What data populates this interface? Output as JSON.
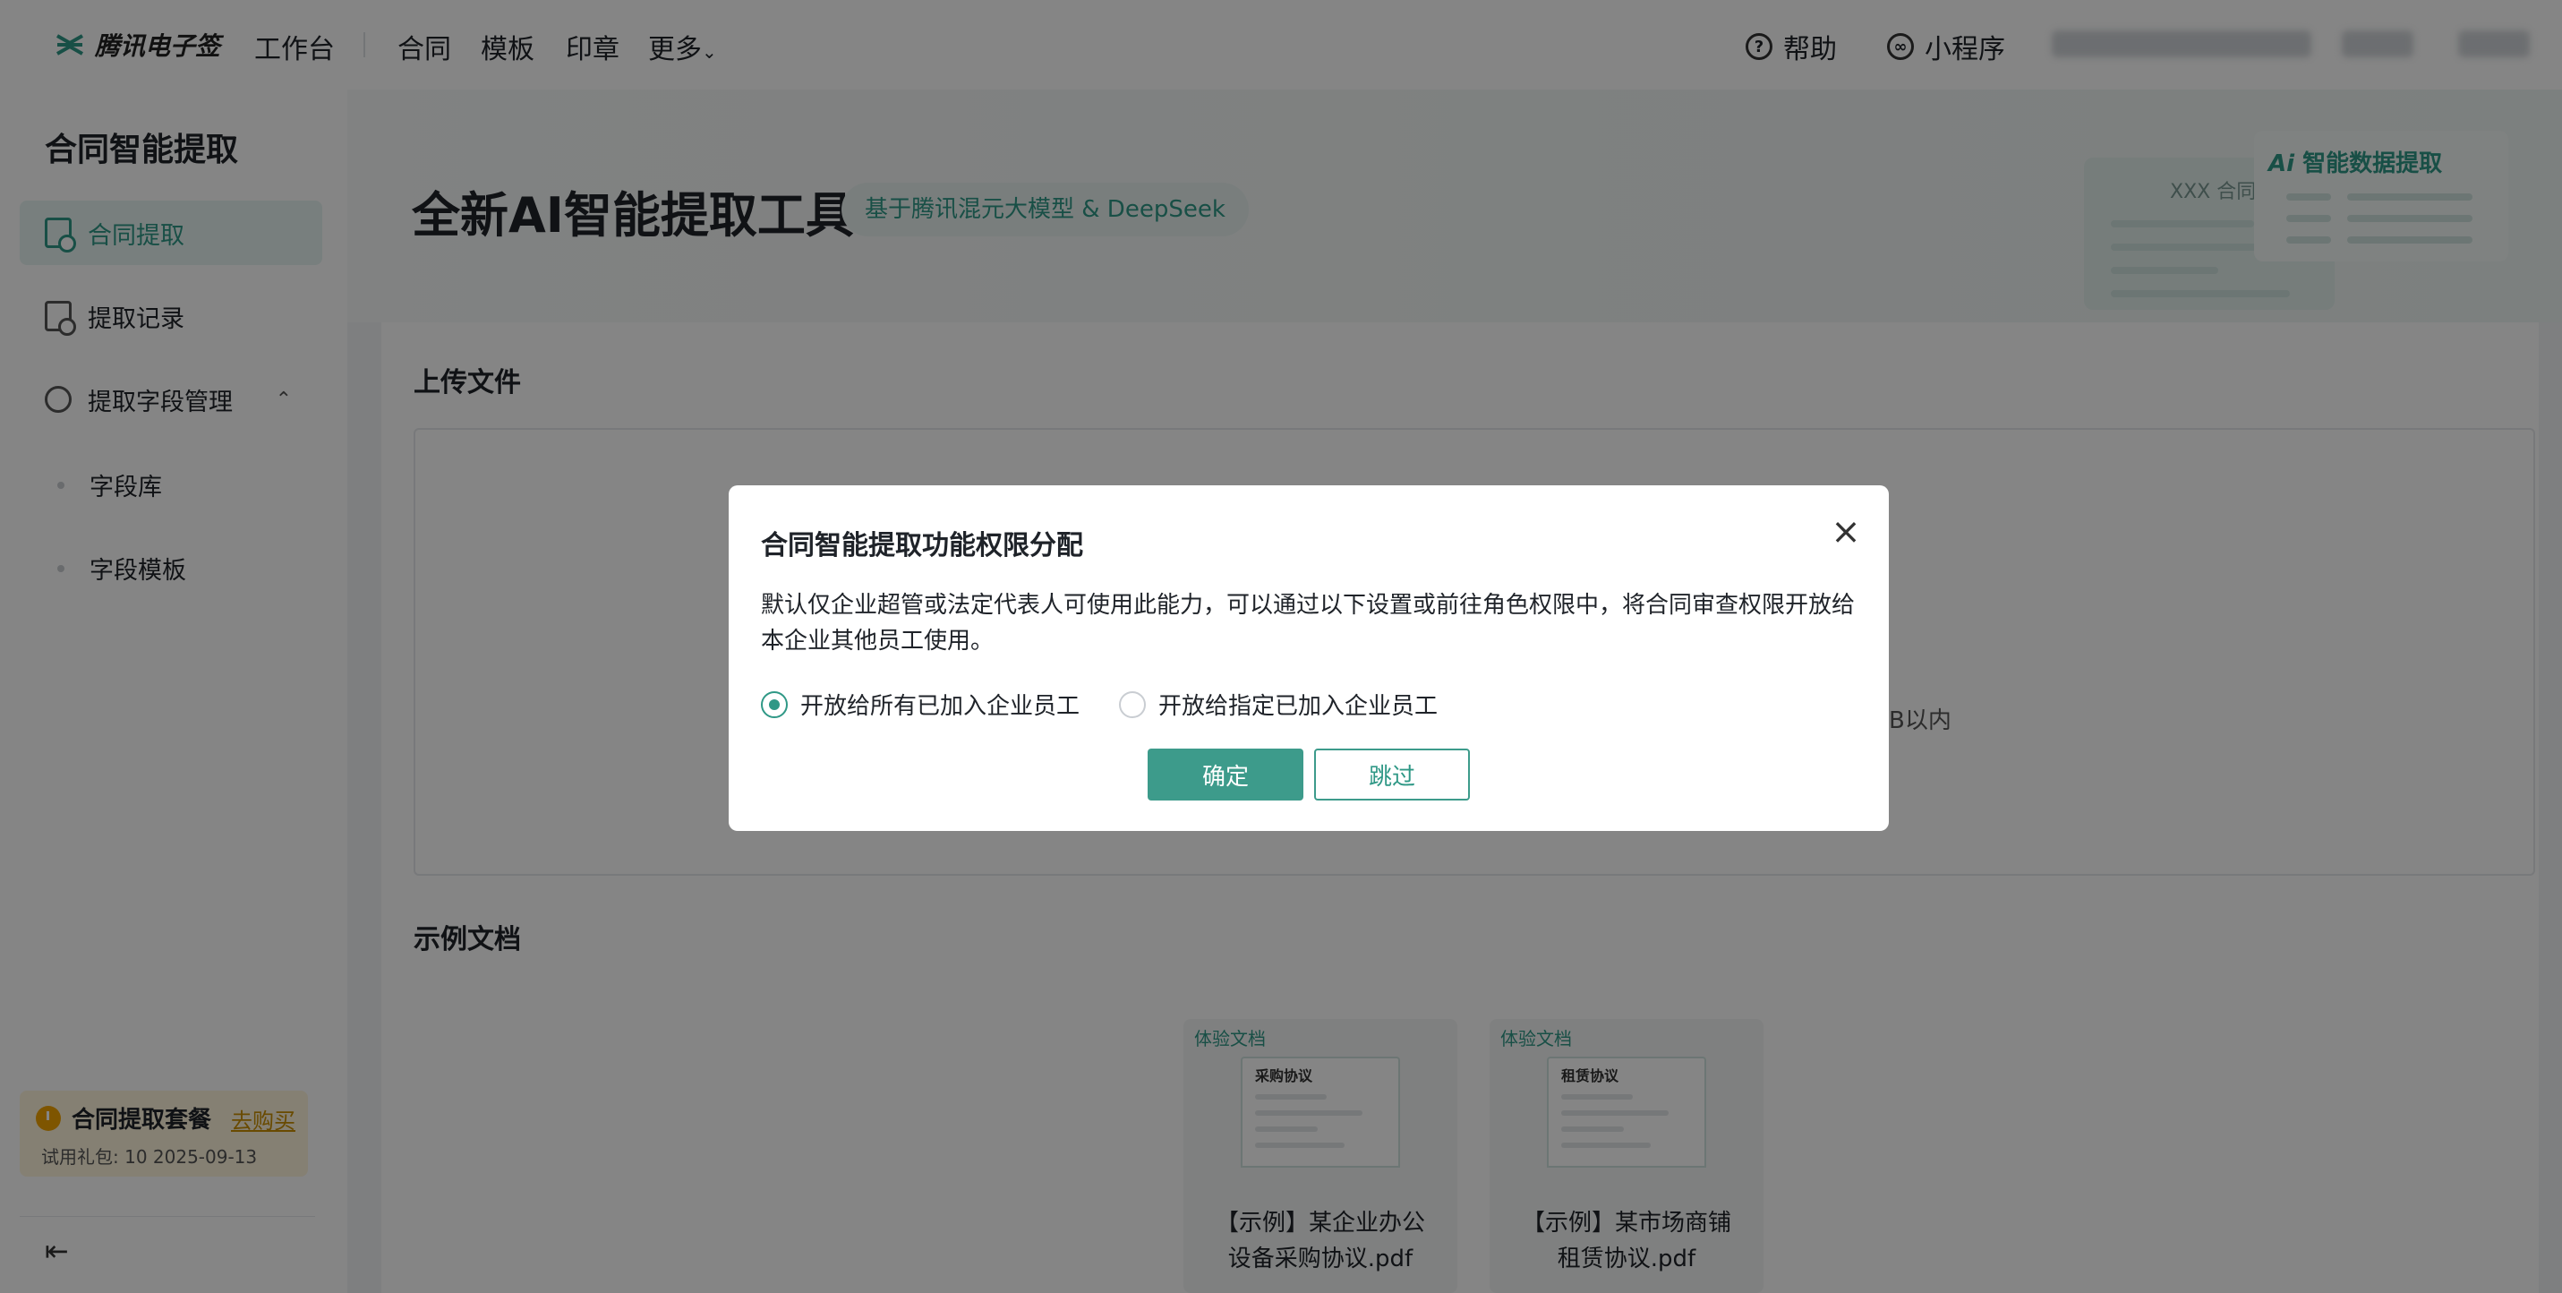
{
  "topbar": {
    "logo_text": "腾讯电子签",
    "nav": [
      "工作台",
      "合同",
      "模板",
      "印章",
      "更多"
    ],
    "help_label": "帮助",
    "miniapp_label": "小程序"
  },
  "sidebar": {
    "title": "合同智能提取",
    "items": [
      {
        "label": "合同提取"
      },
      {
        "label": "提取记录"
      },
      {
        "label": "提取字段管理"
      }
    ],
    "sub_items": [
      {
        "label": "字段库"
      },
      {
        "label": "字段模板"
      }
    ],
    "package": {
      "title": "合同提取套餐",
      "buy_label": "去购买",
      "detail": "试用礼包: 10   2025-09-13"
    }
  },
  "hero": {
    "title": "全新AI智能提取工具",
    "badge": "基于腾讯混元大模型 & DeepSeek",
    "art_card_title": "XXX 合同",
    "art_brand": "智能数据提取"
  },
  "main": {
    "upload_title": "上传文件",
    "upload_hint_fragment": "B以内",
    "examples_title": "示例文档",
    "examples": [
      {
        "tag": "体验文档",
        "doc_title": "采购协议",
        "name_line1": "【示例】某企业办公",
        "name_line2": "设备采购协议.pdf"
      },
      {
        "tag": "体验文档",
        "doc_title": "租赁协议",
        "name_line1": "【示例】某市场商铺",
        "name_line2": "租赁协议.pdf"
      }
    ]
  },
  "modal": {
    "title": "合同智能提取功能权限分配",
    "description": "默认仅企业超管或法定代表人可使用此能力，可以通过以下设置或前往角色权限中，将合同审查权限开放给本企业其他员工使用。",
    "options": [
      {
        "label": "开放给所有已加入企业员工",
        "checked": true
      },
      {
        "label": "开放给指定已加入企业员工",
        "checked": false
      }
    ],
    "confirm_label": "确定",
    "skip_label": "跳过"
  },
  "colors": {
    "accent": "#2f9886",
    "button_primary": "#3d9b8b",
    "overlay": "rgba(0,0,0,0.48)",
    "package_bg": "#fff5dd"
  },
  "icons": [
    "logo-icon",
    "help-icon",
    "miniapp-icon",
    "contract-extract-icon",
    "history-icon",
    "field-manage-icon",
    "chevron-up-icon",
    "clock-icon",
    "collapse-sidebar-icon",
    "close-icon"
  ]
}
